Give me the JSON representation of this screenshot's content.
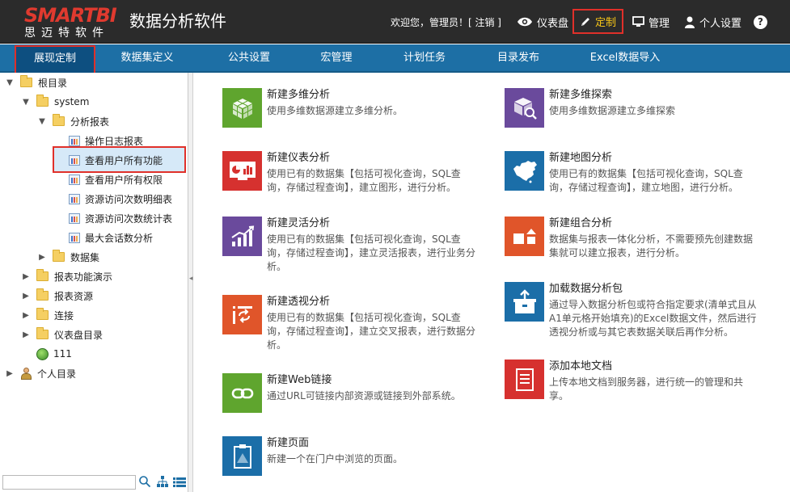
{
  "header": {
    "logo_text": "SMARTBI",
    "logo_sub": "思迈特软件",
    "app_title": "数据分析软件",
    "welcome": "欢迎您，管理员！[ 注销 ]",
    "buttons": {
      "dashboard": "仪表盘",
      "custom": "定制",
      "manage": "管理",
      "settings": "个人设置",
      "help": "?"
    },
    "colors": {
      "bg": "#2b2b2b",
      "logo_red": "#e03a2f",
      "highlight": "#e0302a",
      "active_text": "#f5c518"
    }
  },
  "nav": {
    "tabs": [
      {
        "label": "展现定制",
        "active": true
      },
      {
        "label": "数据集定义"
      },
      {
        "label": "公共设置"
      },
      {
        "label": "宏管理"
      },
      {
        "label": "计划任务"
      },
      {
        "label": "目录发布"
      },
      {
        "label": "Excel数据导入"
      }
    ],
    "color": "#1d6fa5"
  },
  "tree": {
    "items": [
      {
        "label": "根目录",
        "type": "folder",
        "arrow": "▼"
      },
      {
        "label": "system",
        "type": "folder",
        "arrow": "▼"
      },
      {
        "label": "分析报表",
        "type": "folder",
        "arrow": "▼"
      },
      {
        "label": "操作日志报表",
        "type": "report"
      },
      {
        "label": "查看用户所有功能",
        "type": "report",
        "selected": true
      },
      {
        "label": "查看用户所有权限",
        "type": "report"
      },
      {
        "label": "资源访问次数明细表",
        "type": "report"
      },
      {
        "label": "资源访问次数统计表",
        "type": "report"
      },
      {
        "label": "最大会话数分析",
        "type": "report"
      },
      {
        "label": "数据集",
        "type": "folder",
        "arrow": "▶"
      },
      {
        "label": "报表功能演示",
        "type": "folder",
        "arrow": "▶"
      },
      {
        "label": "报表资源",
        "type": "folder",
        "arrow": "▶"
      },
      {
        "label": "连接",
        "type": "folder",
        "arrow": "▶"
      },
      {
        "label": "仪表盘目录",
        "type": "folder",
        "arrow": "▶"
      },
      {
        "label": "111",
        "type": "globe"
      },
      {
        "label": "个人目录",
        "type": "user",
        "arrow": "▶"
      }
    ],
    "search_placeholder": ""
  },
  "cards": [
    {
      "title": "新建多维分析",
      "desc": "使用多维数据源建立多维分析。",
      "color": "#5fa52e",
      "icon": "cube-icon"
    },
    {
      "title": "新建多维探索",
      "desc": "使用多维数据源建立多维探索",
      "color": "#6a4a9c",
      "icon": "cube-search-icon"
    },
    {
      "title": "新建仪表分析",
      "desc": "使用已有的数据集【包括可视化查询，SQL查询，存储过程查询】，建立图形，进行分析。",
      "color": "#d6312f",
      "icon": "dashboard-chart-icon"
    },
    {
      "title": "新建地图分析",
      "desc": "使用已有的数据集【包括可视化查询，SQL查询，存储过程查询】，建立地图，进行分析。",
      "color": "#1b6ea8",
      "icon": "map-icon"
    },
    {
      "title": "新建灵活分析",
      "desc": "使用已有的数据集【包括可视化查询，SQL查询，存储过程查询】，建立灵活报表，进行业务分析。",
      "color": "#6a4a9c",
      "icon": "trend-chart-icon"
    },
    {
      "title": "新建组合分析",
      "desc": "数据集与报表一体化分析，不需要预先创建数据集就可以建立报表，进行分析。",
      "color": "#e0552a",
      "icon": "shapes-icon"
    },
    {
      "title": "新建透视分析",
      "desc": "使用已有的数据集【包括可视化查询，SQL查询，存储过程查询】，建立交叉报表，进行数据分析。",
      "color": "#e0552a",
      "icon": "pivot-icon"
    },
    {
      "title": "加载数据分析包",
      "desc": "通过导入数据分析包或符合指定要求(清单式且从A1单元格开始填充)的Excel数据文件，然后进行透视分析或与其它表数据关联后再作分析。",
      "color": "#1b6ea8",
      "icon": "package-icon"
    },
    {
      "title": "新建Web链接",
      "desc": "通过URL可链接内部资源或链接到外部系统。",
      "color": "#5fa52e",
      "icon": "link-icon"
    },
    {
      "title": "添加本地文档",
      "desc": "上传本地文档到服务器，进行统一的管理和共享。",
      "color": "#d6312f",
      "icon": "document-icon"
    },
    {
      "title": "新建页面",
      "desc": "新建一个在门户中浏览的页面。",
      "color": "#1b6ea8",
      "icon": "page-icon"
    }
  ]
}
